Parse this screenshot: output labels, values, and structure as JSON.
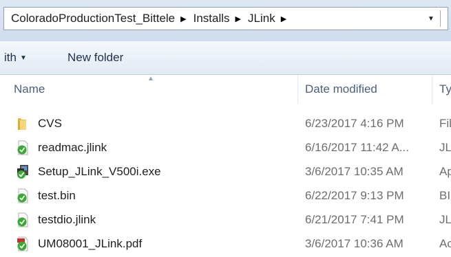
{
  "address_bar": {
    "breadcrumbs": [
      "ColoradoProductionTest_Bittele",
      "Installs",
      "JLink"
    ]
  },
  "toolbar": {
    "open_with_label": "ith",
    "new_folder_label": "New folder"
  },
  "columns": {
    "name": "Name",
    "date_modified": "Date modified",
    "type": "Ty"
  },
  "files": [
    {
      "name": "CVS",
      "date": "6/23/2017 4:16 PM",
      "type": "Fil",
      "icon": "folder-icon"
    },
    {
      "name": "readmac.jlink",
      "date": "6/16/2017 11:42 A...",
      "type": "JLI",
      "icon": "jlink-file-icon"
    },
    {
      "name": "Setup_JLink_V500i.exe",
      "date": "3/6/2017 10:35 AM",
      "type": "Ap",
      "icon": "installer-icon"
    },
    {
      "name": "test.bin",
      "date": "6/22/2017 9:13 PM",
      "type": "BI",
      "icon": "jlink-file-icon"
    },
    {
      "name": "testdio.jlink",
      "date": "6/21/2017 7:41 PM",
      "type": "JLI",
      "icon": "jlink-file-icon"
    },
    {
      "name": "UM08001_JLink.pdf",
      "date": "3/6/2017 10:36 AM",
      "type": "Ac",
      "icon": "pdf-icon"
    }
  ],
  "colors": {
    "jlink_green": "#3aa935",
    "folder_yellow": "#f1cf6b",
    "pdf_red": "#d42a2a"
  }
}
